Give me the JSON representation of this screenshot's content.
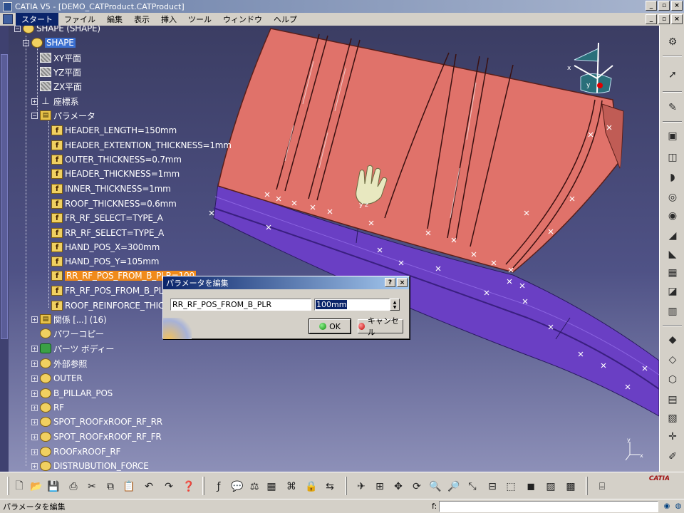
{
  "window": {
    "title": "CATIA V5 - [DEMO_CATProduct.CATProduct]",
    "buttons": [
      "_",
      "▫",
      "×"
    ]
  },
  "menu": {
    "items": [
      "スタート",
      "ファイル",
      "編集",
      "表示",
      "挿入",
      "ツール",
      "ウィンドウ",
      "ヘルプ"
    ],
    "active_index": 0,
    "doc_buttons": [
      "_",
      "▫",
      "×"
    ]
  },
  "tree": {
    "root": "SHAPE (SHAPE)",
    "shape": "SHAPE",
    "planes": [
      "XY平面",
      "YZ平面",
      "ZX平面"
    ],
    "axis": "座標系",
    "params_folder": "パラメータ",
    "params": [
      "HEADER_LENGTH=150mm",
      "HEADER_EXTENTION_THICKNESS=1mm",
      "OUTER_THICKNESS=0.7mm",
      "HEADER_THICKNESS=1mm",
      "INNER_THICKNESS=1mm",
      "ROOF_THICKNESS=0.6mm",
      "FR_RF_SELECT=TYPE_A",
      "RR_RF_SELECT=TYPE_A",
      "HAND_POS_X=300mm",
      "HAND_POS_Y=105mm",
      "RR_RF_POS_FROM_B_PLR=100",
      "FR_RF_POS_FROM_B_PL",
      "ROOF_REINFORCE_THIC"
    ],
    "relations": "関係 [...] (16)",
    "power_copy": "パワーコピー",
    "part_body": "パーツ ボディー",
    "external_ref": "外部参照",
    "features": [
      "OUTER",
      "B_PILLAR_POS",
      "RF",
      "SPOT_ROOFxROOF_RF_RR",
      "SPOT_ROOFxROOF_RF_FR",
      "ROOFxROOF_RF",
      "DISTRUBUTION_FORCE"
    ]
  },
  "compass": {
    "x": "x",
    "y": "y"
  },
  "hand_label": "y z",
  "triad": {
    "y": "y",
    "x": "x"
  },
  "dialog": {
    "title": "パラメータを編集",
    "help": "?",
    "close": "×",
    "param_name": "RR_RF_POS_FROM_B_PLR",
    "value": "100mm",
    "ok": "OK",
    "cancel": "キャンセル"
  },
  "status": {
    "message": "パラメータを編集",
    "cmd_label": "f:"
  },
  "brand": {
    "logo": "CATIA"
  },
  "colors": {
    "surface_top": "#e0726a",
    "surface_side": "#6a3fc4",
    "selection_blue": "#3b6fd0",
    "selection_orange": "#f08a1a",
    "titlebar": "#0a246a"
  }
}
